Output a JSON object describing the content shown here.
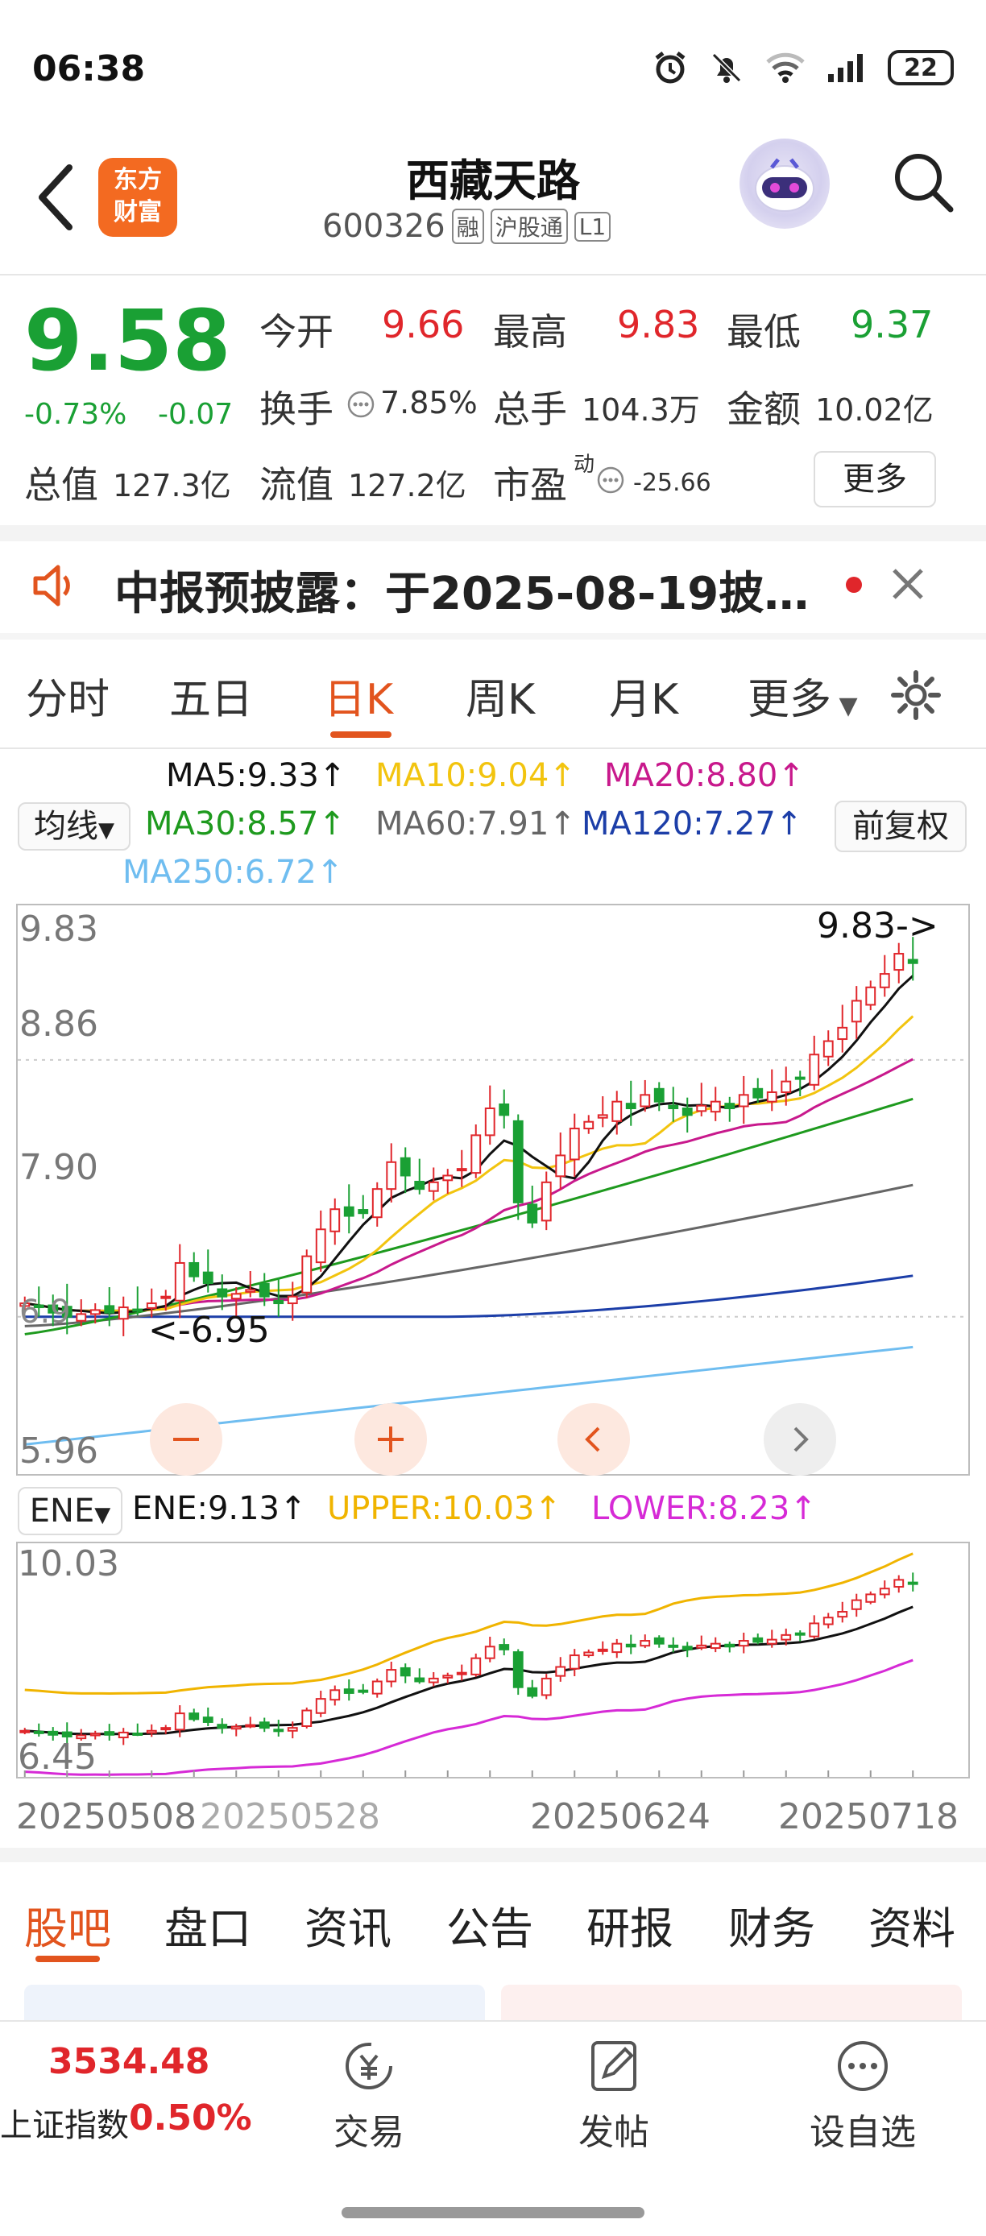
{
  "status": {
    "time": "06:38",
    "battery": "22"
  },
  "header": {
    "logo_line1": "东方",
    "logo_line2": "财富",
    "name": "西藏天路",
    "code": "600326",
    "tags": [
      "融",
      "沪股通",
      "L1"
    ]
  },
  "quote": {
    "price": "9.58",
    "change_pct": "-0.73%",
    "change_val": "-0.07",
    "open_label": "今开",
    "open": "9.66",
    "high_label": "最高",
    "high": "9.83",
    "low_label": "最低",
    "low": "9.37",
    "turnover_label": "换手",
    "turnover": "7.85%",
    "volume_label": "总手",
    "volume": "104.3万",
    "amount_label": "金额",
    "amount": "10.02亿",
    "mktcap_label": "总值",
    "mktcap": "127.3亿",
    "float_label": "流值",
    "float": "127.2亿",
    "pe_label": "市盈",
    "pe_sup": "动",
    "pe": "-25.66",
    "more": "更多"
  },
  "notice": {
    "text": "中报预披露：于2025-08-19披…"
  },
  "period_tabs": [
    "分时",
    "五日",
    "日K",
    "周K",
    "月K",
    "更多"
  ],
  "ma_legend": {
    "selector": "均线",
    "ma5": "MA5:9.33↑",
    "ma10": "MA10:9.04↑",
    "ma20": "MA20:8.80↑",
    "ma30": "MA30:8.57↑",
    "ma60": "MA60:7.91↑",
    "ma120": "MA120:7.27↑",
    "ma250": "MA250:6.72↑",
    "adjust": "前复权"
  },
  "colors": {
    "up": "#e0262b",
    "down": "#1aa034",
    "ma5": "#111111",
    "ma10": "#f2c40f",
    "ma20": "#c8198c",
    "ma30": "#1e9a1e",
    "ma60": "#666666",
    "ma120": "#1c3ea8",
    "ma250": "#6fbdf0",
    "ene_upper": "#f0b400",
    "ene_lower": "#d62ad6",
    "accent": "#e2541e"
  },
  "main_chart": {
    "y_labels": [
      "9.83",
      "8.86",
      "7.90",
      "5.96"
    ],
    "max_label": "9.83->",
    "min_label": "<-6.95",
    "min_left_label": "6.9"
  },
  "ene": {
    "selector": "ENE",
    "ene": "ENE:9.13↑",
    "upper": "UPPER:10.03↑",
    "lower": "LOWER:8.23↑",
    "y_top": "10.03",
    "y_bottom": "6.45"
  },
  "x_dates": [
    "20250508",
    "20250528",
    "20250624",
    "20250718"
  ],
  "bottom_tabs": [
    "股吧",
    "盘口",
    "资讯",
    "公告",
    "研报",
    "财务",
    "资料"
  ],
  "footer": {
    "index_value": "3534.48",
    "index_name": "上证指数",
    "index_pct": "0.50%",
    "trade": "交易",
    "post": "发帖",
    "watch": "设自选"
  },
  "chart_data": {
    "type": "candlestick",
    "y_range": [
      5.96,
      9.83
    ],
    "candles_approx_close": [
      7.05,
      7.02,
      6.98,
      6.95,
      6.97,
      7.0,
      6.98,
      7.02,
      7.0,
      7.05,
      7.1,
      7.35,
      7.25,
      7.2,
      7.1,
      7.12,
      7.15,
      7.1,
      7.05,
      7.1,
      7.4,
      7.6,
      7.75,
      7.7,
      7.72,
      7.9,
      8.1,
      8.0,
      7.9,
      7.95,
      8.0,
      8.05,
      8.3,
      8.5,
      8.45,
      7.8,
      7.65,
      7.95,
      8.15,
      8.35,
      8.4,
      8.45,
      8.55,
      8.5,
      8.6,
      8.55,
      8.5,
      8.45,
      8.52,
      8.55,
      8.5,
      8.6,
      8.58,
      8.62,
      8.7,
      8.72,
      8.9,
      9.0,
      9.1,
      9.3,
      9.4,
      9.5,
      9.65,
      9.58
    ],
    "ene_upper_last": 10.03,
    "ene_mid_last": 9.13,
    "ene_lower_last": 8.23
  }
}
